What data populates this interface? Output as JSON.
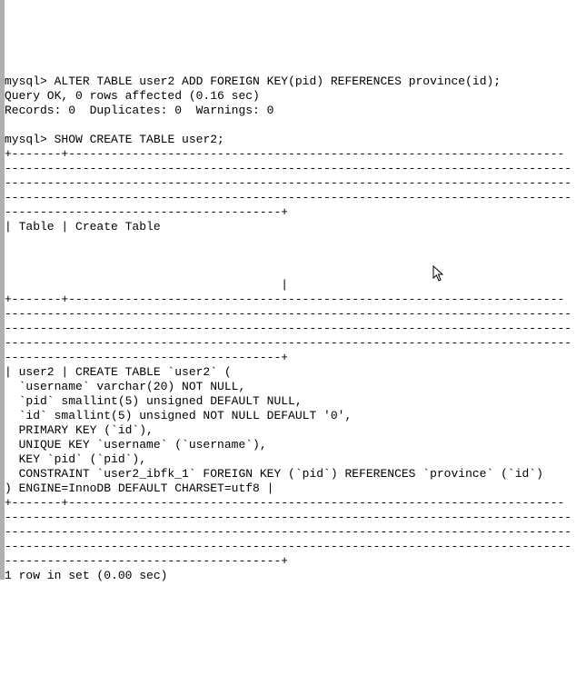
{
  "prompt": "mysql>",
  "cmd1": "ALTER TABLE user2 ADD FOREIGN KEY(pid) REFERENCES province(id);",
  "result1a": "Query OK, 0 rows affected (0.16 sec)",
  "result1b": "Records: 0  Duplicates: 0  Warnings: 0",
  "cmd2": "SHOW CREATE TABLE user2;",
  "border_top": "+-------+----------------------------------------------------------------------",
  "border_dashes": "--------------------------------------------------------------------------------",
  "border_end_short": "---------------------------------------+",
  "header_row": "| Table | Create Table",
  "header_end": "                                       |",
  "data_l1": "| user2 | CREATE TABLE `user2` (",
  "data_l2": "  `username` varchar(20) NOT NULL,",
  "data_l3": "  `pid` smallint(5) unsigned DEFAULT NULL,",
  "data_l4": "  `id` smallint(5) unsigned NOT NULL DEFAULT '0',",
  "data_l5": "  PRIMARY KEY (`id`),",
  "data_l6": "  UNIQUE KEY `username` (`username`),",
  "data_l7": "  KEY `pid` (`pid`),",
  "data_l8": "  CONSTRAINT `user2_ibfk_1` FOREIGN KEY (`pid`) REFERENCES `province` (`id`)",
  "data_l9": ") ENGINE=InnoDB DEFAULT CHARSET=utf8 |",
  "footer": "1 row in set (0.00 sec)",
  "cursor_glyph": "↖"
}
